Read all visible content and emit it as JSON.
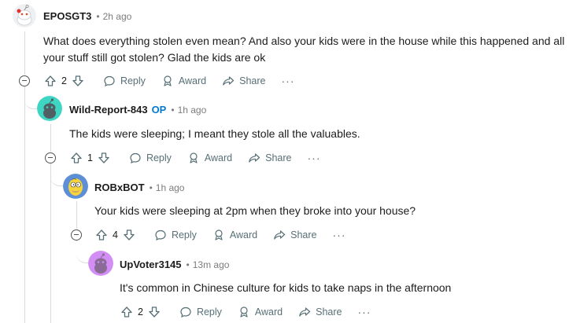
{
  "comments": [
    {
      "author": "EPOSGT3",
      "op_badge": "",
      "separator": "•",
      "time": "2h ago",
      "text": "What does everything stolen even mean? And also your kids were in the house while this happened and all your stuff still got stolen? Glad the kids are ok",
      "votes": "2",
      "avatar": "snoo-white-avatar"
    },
    {
      "author": "Wild-Report-843",
      "op_badge": "OP",
      "separator": "•",
      "time": "1h ago",
      "text": "The kids were sleeping; I meant they stole all the valuables.",
      "votes": "1",
      "avatar": "snoo-teal-avatar"
    },
    {
      "author": "ROBxBOT",
      "op_badge": "",
      "separator": "•",
      "time": "1h ago",
      "text": "Your kids were sleeping at 2pm when they broke into your house?",
      "votes": "4",
      "avatar": "homer-avatar"
    },
    {
      "author": "UpVoter3145",
      "op_badge": "",
      "separator": "•",
      "time": "13m ago",
      "text": "It's common in Chinese culture for kids to take naps in the afternoon",
      "votes": "2",
      "avatar": "snoo-purple-avatar"
    }
  ],
  "actions": {
    "reply": "Reply",
    "award": "Award",
    "share": "Share",
    "more": "···"
  },
  "colors": {
    "op_blue": "#0079d3",
    "thread_line": "#d7dadc",
    "meta_gray": "#7c7c7c",
    "action_gray": "#576f76",
    "teal": "#3ed6c3",
    "purple": "#d28ef4"
  },
  "icons": [
    "collapse-icon",
    "upvote-icon",
    "downvote-icon",
    "reply-icon",
    "award-icon",
    "share-icon",
    "more-icon"
  ]
}
